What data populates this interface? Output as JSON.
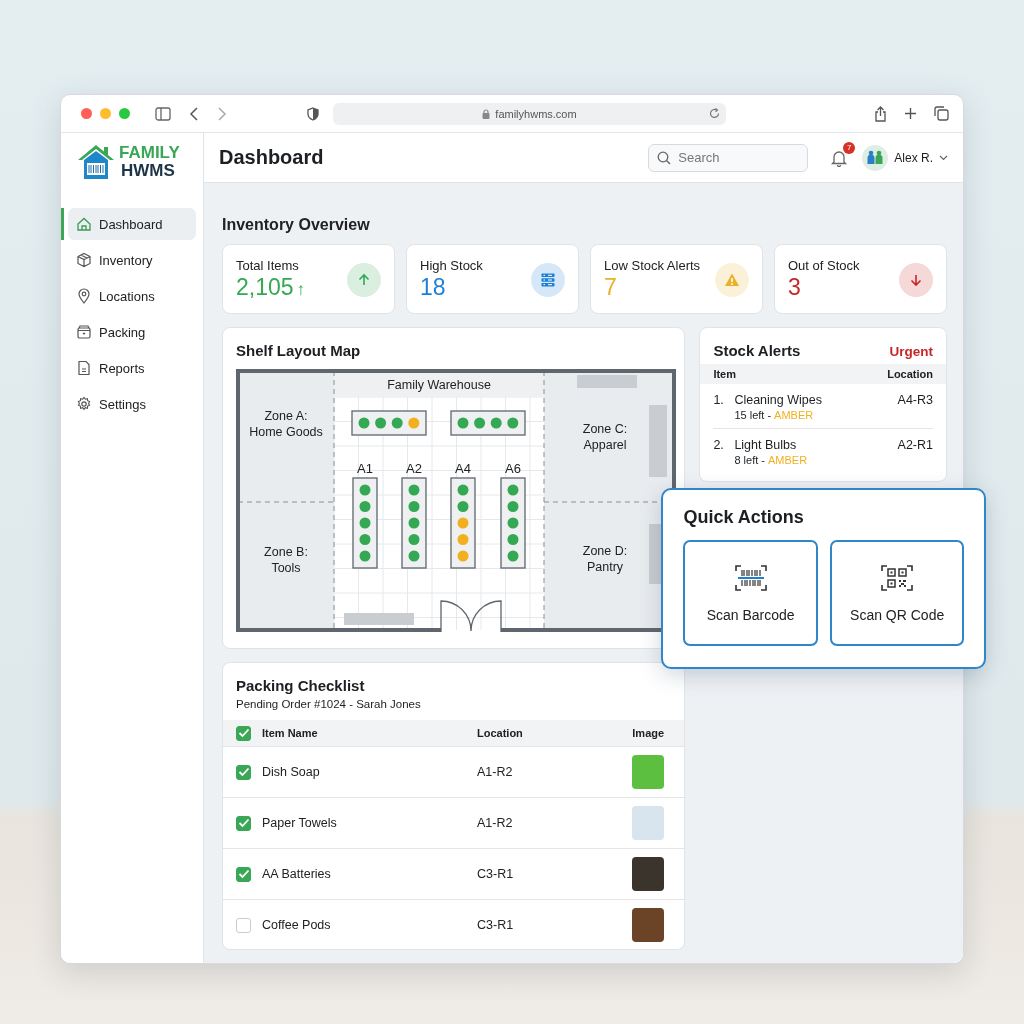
{
  "browser": {
    "url": "familyhwms.com"
  },
  "brand": {
    "line_1": "FAMILY",
    "line_2": "HWMS"
  },
  "sidebar": {
    "items": [
      {
        "label": "Dashboard",
        "kind": "home",
        "selected": true
      },
      {
        "label": "Inventory",
        "kind": "box",
        "selected": false
      },
      {
        "label": "Locations",
        "kind": "pin",
        "selected": false
      },
      {
        "label": "Packing",
        "kind": "package",
        "selected": false
      },
      {
        "label": "Reports",
        "kind": "document",
        "selected": false
      },
      {
        "label": "Settings",
        "kind": "gear",
        "selected": false
      }
    ]
  },
  "header": {
    "title": "Dashboard",
    "search": {
      "placeholder": "Search"
    },
    "notifications": {
      "count": "7"
    },
    "user": {
      "name": "Alex R."
    }
  },
  "overview": {
    "title": "Inventory Overview",
    "stats": [
      {
        "label": "Total Items",
        "value": "2,105",
        "trend": "↑",
        "kind": "up",
        "color": "#34a853"
      },
      {
        "label": "High Stock",
        "value": "18",
        "kind": "stack",
        "color": "#1e7fd6"
      },
      {
        "label": "Low Stock Alerts",
        "value": "7",
        "kind": "warning",
        "color": "#eab028"
      },
      {
        "label": "Out of Stock",
        "value": "3",
        "kind": "down",
        "color": "#c62828"
      }
    ]
  },
  "shelf_map": {
    "title": "Shelf Layout Map",
    "warehouse_label": "Family Warehouse",
    "zones": [
      {
        "code": "Zone A:",
        "name": "Home Goods"
      },
      {
        "code": "Zone B:",
        "name": "Tools"
      },
      {
        "code": "Zone C:",
        "name": "Apparel"
      },
      {
        "code": "Zone D:",
        "name": "Pantry"
      }
    ],
    "top_shelves": [
      {
        "slots": [
          {
            "color": "#34a853"
          },
          {
            "color": "#34a853"
          },
          {
            "color": "#34a853"
          },
          {
            "color": "#f2b01e"
          }
        ]
      },
      {
        "slots": [
          {
            "color": "#34a853"
          },
          {
            "color": "#34a853"
          },
          {
            "color": "#34a853"
          },
          {
            "color": "#34a853"
          }
        ]
      }
    ],
    "aisles": [
      {
        "label": "A1",
        "slots": [
          {
            "color": "#34a853"
          },
          {
            "color": "#34a853"
          },
          {
            "color": "#34a853"
          },
          {
            "color": "#34a853"
          },
          {
            "color": "#34a853"
          }
        ]
      },
      {
        "label": "A2",
        "slots": [
          {
            "color": "#34a853"
          },
          {
            "color": "#34a853"
          },
          {
            "color": "#34a853"
          },
          {
            "color": "#34a853"
          },
          {
            "color": "#34a853"
          }
        ]
      },
      {
        "label": "A4",
        "slots": [
          {
            "color": "#34a853"
          },
          {
            "color": "#34a853"
          },
          {
            "color": "#f2b01e"
          },
          {
            "color": "#f2b01e"
          },
          {
            "color": "#f2b01e"
          }
        ]
      },
      {
        "label": "A6",
        "slots": [
          {
            "color": "#34a853"
          },
          {
            "color": "#34a853"
          },
          {
            "color": "#34a853"
          },
          {
            "color": "#34a853"
          },
          {
            "color": "#34a853"
          }
        ]
      }
    ]
  },
  "stock_alerts": {
    "title": "Stock Alerts",
    "badge": "Urgent",
    "columns": [
      "Item",
      "Location"
    ],
    "items": [
      {
        "number": "1.",
        "name": "Cleaning Wipes",
        "detail": "15 left -",
        "status": "AMBER",
        "color": "#f2b01e",
        "location": "A4-R3"
      },
      {
        "number": "2.",
        "name": "Light Bulbs",
        "detail": "8 left -",
        "status": "AMBER",
        "color": "#f2b01e",
        "location": "A2-R1"
      }
    ]
  },
  "quick_actions": {
    "title": "Quick Actions",
    "buttons": [
      {
        "label": "Scan Barcode",
        "kind": "barcode"
      },
      {
        "label": "Scan QR Code",
        "kind": "qr"
      }
    ]
  },
  "packing_checklist": {
    "title": "Packing Checklist",
    "subtitle": "Pending Order #1024 - Sarah Jones",
    "header": {
      "checked": true,
      "columns": [
        "Item Name",
        "Location",
        "Image"
      ]
    },
    "rows": [
      {
        "name": "Dish Soap",
        "location": "A1-R2",
        "checked": true
      },
      {
        "name": "Paper Towels",
        "location": "A1-R2",
        "checked": true
      },
      {
        "name": "AA Batteries",
        "location": "C3-R1",
        "checked": true
      },
      {
        "name": "Coffee Pods",
        "location": "C3-R1",
        "checked": false
      }
    ]
  }
}
